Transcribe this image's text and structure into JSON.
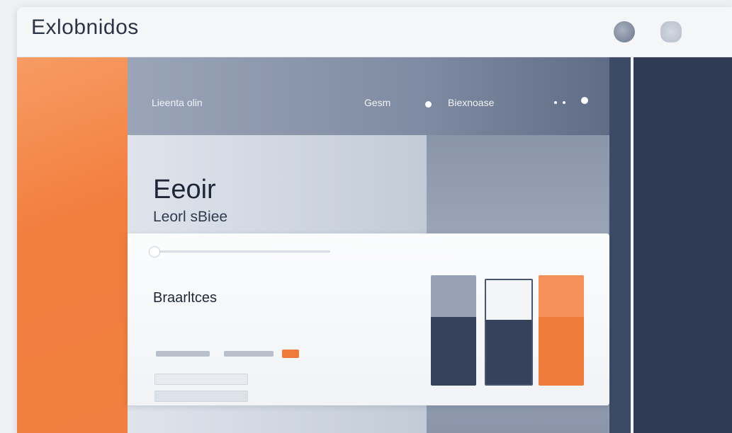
{
  "window": {
    "title": "Exlobnidos"
  },
  "titlebar": {
    "buttons": [
      {
        "icon": "circle-icon"
      },
      {
        "icon": "pin-icon"
      }
    ]
  },
  "nav": {
    "items": [
      {
        "label": "Lieenta olin"
      },
      {
        "label": "Gesm"
      },
      {
        "label": "Biexnoase"
      }
    ],
    "more_icon": "ellipsis-icon"
  },
  "hero": {
    "title": "Eeoir",
    "subtitle": "Leorl sBiee"
  },
  "card": {
    "heading": "Braarltces",
    "slider": {
      "value": 0.0
    },
    "fields": [
      {
        "value": ""
      },
      {
        "value": ""
      }
    ]
  },
  "chart_data": {
    "type": "bar",
    "categories": [
      "",
      "",
      ""
    ],
    "values": [
      0.71,
      0.67,
      0.71
    ],
    "series_colors": {
      "bar1": {
        "top": "#97a2b5",
        "bottom": "#364259"
      },
      "bar2": {
        "top": "#f4f5f7",
        "bottom": "#364259"
      },
      "bar3": {
        "top": "#f5905b",
        "bottom": "#f07a3a"
      }
    },
    "split": [
      0.38,
      0.38,
      0.38
    ]
  },
  "colors": {
    "accent": "#f07a3a",
    "navy": "#2f3b55",
    "slate": "#8e9ab0"
  }
}
